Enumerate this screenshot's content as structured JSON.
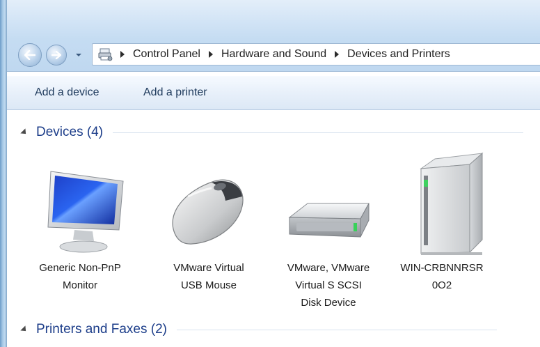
{
  "window": {
    "address": {
      "breadcrumbs": [
        "Control Panel",
        "Hardware and Sound",
        "Devices and Printers"
      ]
    }
  },
  "toolbar": {
    "add_device_label": "Add a device",
    "add_printer_label": "Add a printer"
  },
  "groups": {
    "devices": {
      "title": "Devices (4)"
    },
    "printers": {
      "title": "Printers and Faxes (2)"
    }
  },
  "devices": [
    {
      "line1": "Generic Non-PnP",
      "line2": "Monitor",
      "line3": "",
      "icon": "monitor-icon"
    },
    {
      "line1": "VMware Virtual",
      "line2": "USB Mouse",
      "line3": "",
      "icon": "mouse-icon"
    },
    {
      "line1": "VMware, VMware",
      "line2": "Virtual S SCSI",
      "line3": "Disk Device",
      "icon": "hard-disk-icon"
    },
    {
      "line1": "WIN-CRBNNRSR",
      "line2": "0O2",
      "line3": "",
      "icon": "computer-tower-icon"
    }
  ],
  "colors": {
    "group_title": "#1d3e8a",
    "command_text": "#1e3a5c",
    "frame_glass": "#c5dcf2"
  }
}
